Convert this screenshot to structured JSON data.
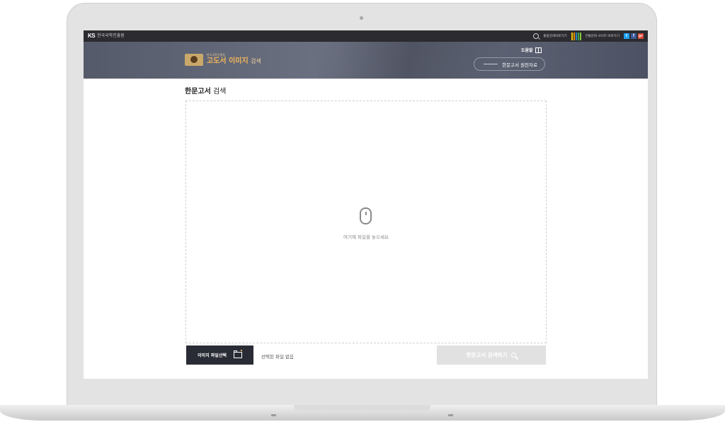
{
  "topbar": {
    "org_logo": "KS",
    "org_name": "한국국학진흥원",
    "integrated_search": "통합검색바로가기",
    "culture_site": "전통문화 사이트 바로가기",
    "stripe_colors": [
      "#f2c200",
      "#e08a00",
      "#2f7dc6",
      "#3aa54a",
      "#8cc63f"
    ],
    "social": [
      {
        "icon": "twitter-icon",
        "glyph": "t",
        "color": "#1da1f2"
      },
      {
        "icon": "facebook-icon",
        "glyph": "f",
        "color": "#3b5998"
      },
      {
        "icon": "googleplus-icon",
        "glyph": "g+",
        "color": "#d34836"
      }
    ]
  },
  "banner": {
    "brand_sub": "한국국학진흥원",
    "brand_title_bold": "고도서 이미지",
    "brand_title_light": "검색",
    "help": "도움말",
    "original_button": "한문고서 원천자료"
  },
  "main": {
    "title_bold": "한문고서",
    "title_light": "검색",
    "drop_text": "여기에 파일을 놓으세요",
    "file_select": "이미지 파일선택",
    "no_file": "선택된 파일 없음",
    "search_button": "한문고서 검색하기"
  }
}
